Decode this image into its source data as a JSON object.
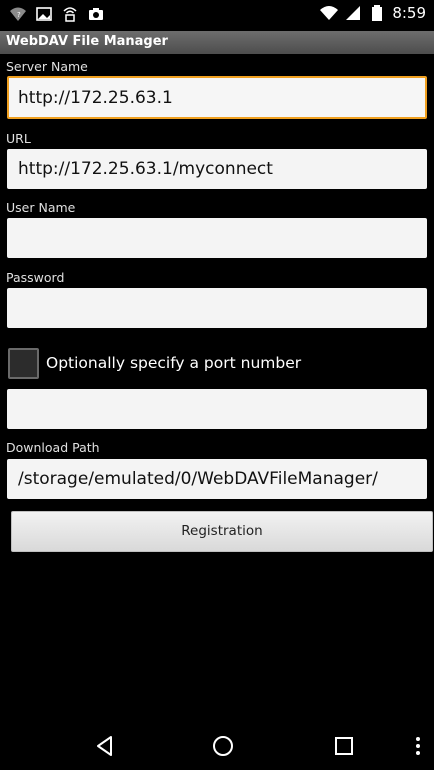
{
  "status_bar": {
    "time": "8:59",
    "left_icons": [
      "wifi-question-icon",
      "image-icon",
      "network-tower-icon",
      "camera-icon"
    ],
    "right_icons": [
      "wifi-icon",
      "signal-icon",
      "battery-icon"
    ]
  },
  "app": {
    "title": "WebDAV File Manager"
  },
  "form": {
    "server_name": {
      "label": "Server Name",
      "value": "http://172.25.63.1"
    },
    "url": {
      "label": "URL",
      "value": "http://172.25.63.1/myconnect"
    },
    "user_name": {
      "label": "User Name",
      "value": ""
    },
    "password": {
      "label": "Password",
      "value": ""
    },
    "port": {
      "checkbox_label": "Optionally specify a port number",
      "checked": false,
      "value": ""
    },
    "download_path": {
      "label": "Download Path",
      "value": "/storage/emulated/0/WebDAVFileManager/"
    },
    "register_label": "Registration"
  },
  "nav": {
    "icons": [
      "back-icon",
      "home-icon",
      "recents-icon",
      "overflow-menu-icon"
    ]
  },
  "colors": {
    "focus_accent": "#f0a020",
    "title_bar": "#5a5a5a"
  }
}
